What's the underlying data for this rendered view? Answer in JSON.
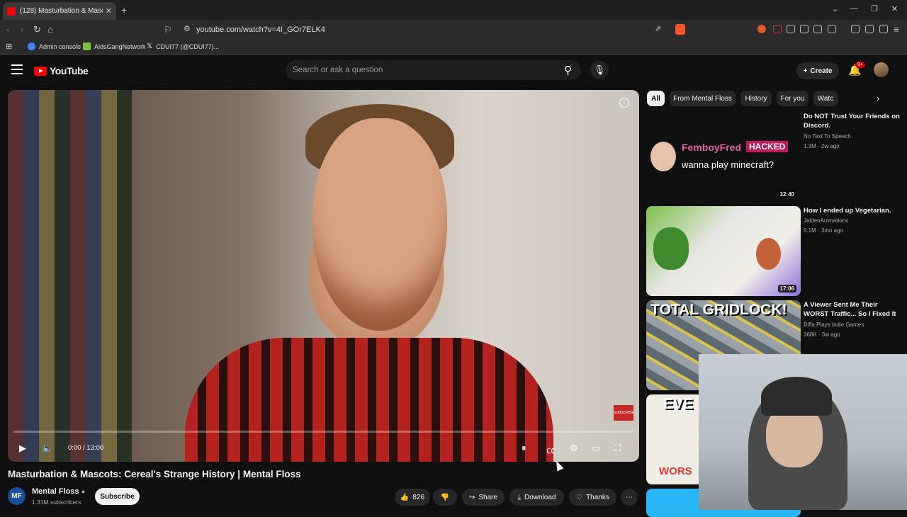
{
  "browser": {
    "tab_title": "(128) Masturbation & Mascots: C",
    "url": "youtube.com/watch?v=4I_GOr7ELK4",
    "bookmarks": [
      "Admin console",
      "AidsGangNetwork",
      "CDUI77 (@CDUI77)..."
    ]
  },
  "header": {
    "logo_text": "YouTube",
    "search_placeholder": "Search or ask a question",
    "create_label": "Create",
    "notification_badge": "9+"
  },
  "video": {
    "time": "0:00 / 13:00",
    "watermark": "SUBSCRIBE",
    "title": "Masturbation & Mascots: Cereal's Strange History | Mental Floss",
    "progress": 0
  },
  "channel": {
    "avatar_text": "MF",
    "name": "Mental Floss",
    "subscribers": "1.31M subscribers",
    "subscribe_label": "Subscribe"
  },
  "actions": {
    "likes": "826",
    "share": "Share",
    "download": "Download",
    "thanks": "Thanks"
  },
  "chips": [
    "All",
    "From Mental Floss",
    "History",
    "For you",
    "Watc"
  ],
  "recommendations": [
    {
      "title": "Do NOT Trust Your Friends on Discord.",
      "channel": "No Text To Speech",
      "meta": "1.3M · 2w ago",
      "duration": "32:40",
      "thumb_text_1": "FemboyFred",
      "thumb_text_2": "HACKED",
      "thumb_text_3": "wanna play minecraft?"
    },
    {
      "title": "How I ended up Vegetarian.",
      "channel": "JaidenAnimations",
      "meta": "5.1M · 3mo ago",
      "duration": "17:06"
    },
    {
      "title": "A Viewer Sent Me Their WORST Traffic... So I Fixed It",
      "channel": "Biffa Plays Indie Games",
      "meta": "368K · 3w ago",
      "duration": "",
      "thumb_text_1": "TOTAL GRIDLOCK!"
    },
    {
      "title": "",
      "channel": "",
      "meta": "",
      "duration": "",
      "thumb_text_1": "EVE",
      "thumb_text_2": "WORS"
    }
  ],
  "colors": {
    "accent": "#ff0000",
    "background": "#0f0f0f",
    "chip": "#272727"
  }
}
